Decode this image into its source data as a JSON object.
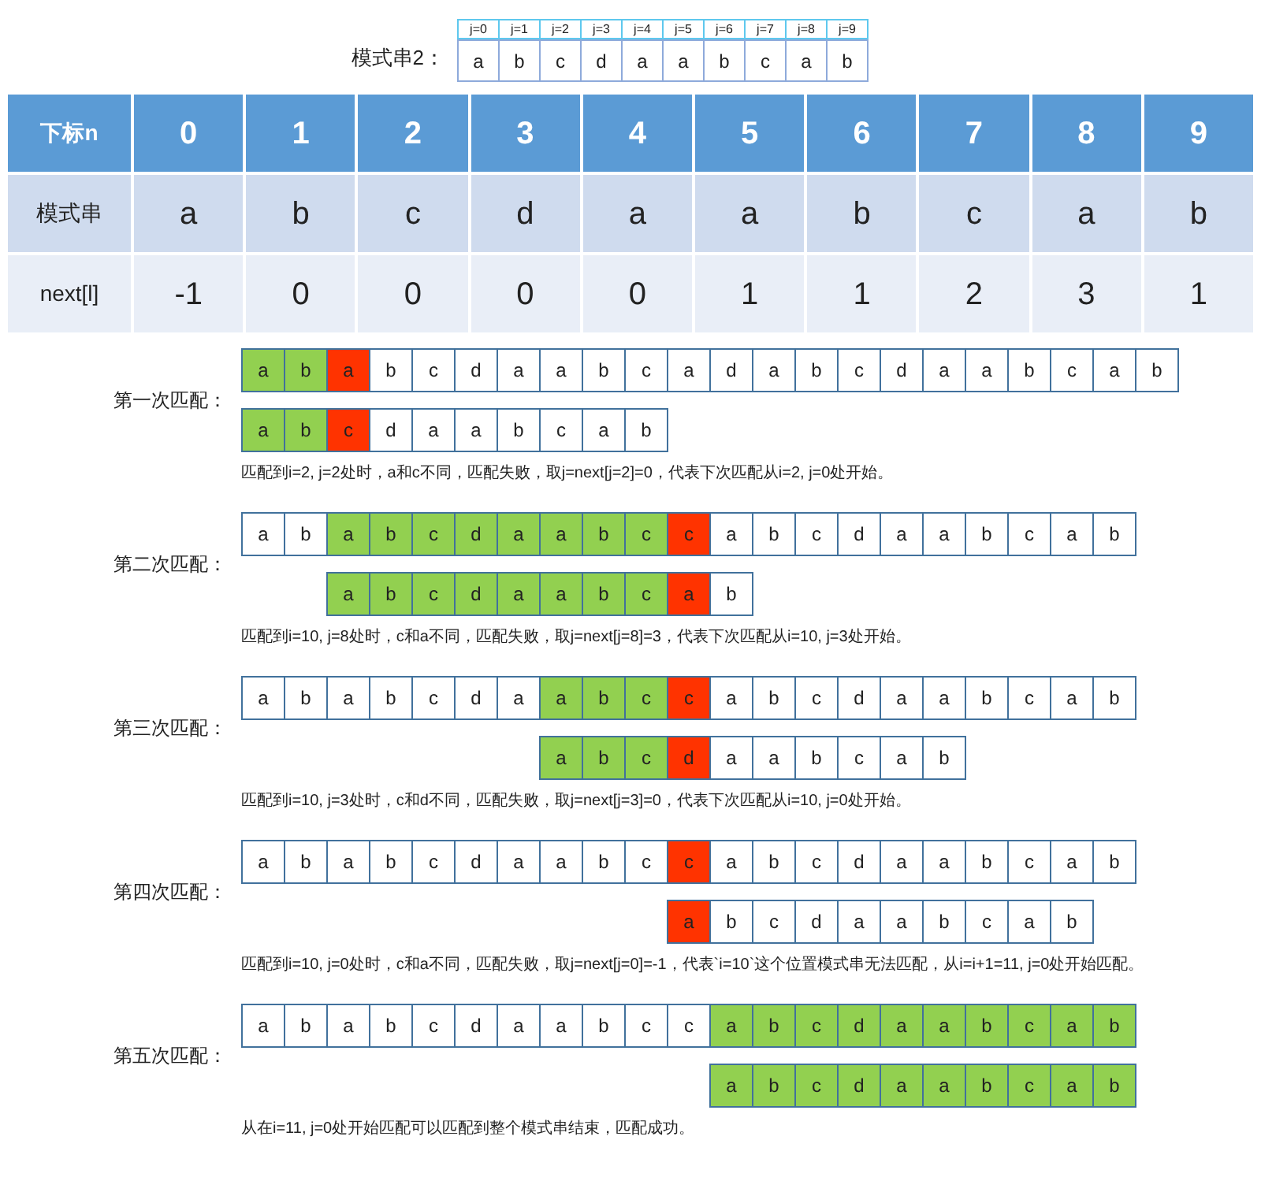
{
  "pattern_2": {
    "label": "模式串2：",
    "indices": [
      "j=0",
      "j=1",
      "j=2",
      "j=3",
      "j=4",
      "j=5",
      "j=6",
      "j=7",
      "j=8",
      "j=9"
    ],
    "chars": [
      "a",
      "b",
      "c",
      "d",
      "a",
      "a",
      "b",
      "c",
      "a",
      "b"
    ]
  },
  "table": {
    "rows": [
      {
        "kind": "header",
        "label": "下标n",
        "cells": [
          "0",
          "1",
          "2",
          "3",
          "4",
          "5",
          "6",
          "7",
          "8",
          "9"
        ]
      },
      {
        "kind": "pattern",
        "label": "模式串",
        "cells": [
          "a",
          "b",
          "c",
          "d",
          "a",
          "a",
          "b",
          "c",
          "a",
          "b"
        ]
      },
      {
        "kind": "next",
        "label": "next[l]",
        "cells": [
          "-1",
          "0",
          "0",
          "0",
          "0",
          "1",
          "1",
          "2",
          "3",
          "1"
        ]
      }
    ]
  },
  "rounds": [
    {
      "label": "第一次匹配：",
      "main": [
        {
          "c": "a",
          "matched": true,
          "mismatched": false
        },
        {
          "c": "b",
          "matched": true,
          "mismatched": false
        },
        {
          "c": "a",
          "matched": false,
          "mismatched": true
        },
        {
          "c": "b",
          "matched": false,
          "mismatched": false
        },
        {
          "c": "c",
          "matched": false,
          "mismatched": false
        },
        {
          "c": "d",
          "matched": false,
          "mismatched": false
        },
        {
          "c": "a",
          "matched": false,
          "mismatched": false
        },
        {
          "c": "a",
          "matched": false,
          "mismatched": false
        },
        {
          "c": "b",
          "matched": false,
          "mismatched": false
        },
        {
          "c": "c",
          "matched": false,
          "mismatched": false
        },
        {
          "c": "a",
          "matched": false,
          "mismatched": false
        },
        {
          "c": "d",
          "matched": false,
          "mismatched": false
        },
        {
          "c": "a",
          "matched": false,
          "mismatched": false
        },
        {
          "c": "b",
          "matched": false,
          "mismatched": false
        },
        {
          "c": "c",
          "matched": false,
          "mismatched": false
        },
        {
          "c": "d",
          "matched": false,
          "mismatched": false
        },
        {
          "c": "a",
          "matched": false,
          "mismatched": false
        },
        {
          "c": "a",
          "matched": false,
          "mismatched": false
        },
        {
          "c": "b",
          "matched": false,
          "mismatched": false
        },
        {
          "c": "c",
          "matched": false,
          "mismatched": false
        },
        {
          "c": "a",
          "matched": false,
          "mismatched": false
        },
        {
          "c": "b",
          "matched": false,
          "mismatched": false
        }
      ],
      "pattern": [
        {
          "c": "a",
          "matched": true,
          "mismatched": false
        },
        {
          "c": "b",
          "matched": true,
          "mismatched": false
        },
        {
          "c": "c",
          "matched": false,
          "mismatched": true
        },
        {
          "c": "d",
          "matched": false,
          "mismatched": false
        },
        {
          "c": "a",
          "matched": false,
          "mismatched": false
        },
        {
          "c": "a",
          "matched": false,
          "mismatched": false
        },
        {
          "c": "b",
          "matched": false,
          "mismatched": false
        },
        {
          "c": "c",
          "matched": false,
          "mismatched": false
        },
        {
          "c": "a",
          "matched": false,
          "mismatched": false
        },
        {
          "c": "b",
          "matched": false,
          "mismatched": false
        }
      ],
      "caption": "匹配到i=2, j=2处时，a和c不同，匹配失败，取j=next[j=2]=0，代表下次匹配从i=2, j=0处开始。"
    },
    {
      "label": "第二次匹配：",
      "main": [
        {
          "c": "a",
          "matched": false,
          "mismatched": false
        },
        {
          "c": "b",
          "matched": false,
          "mismatched": false
        },
        {
          "c": "a",
          "matched": true,
          "mismatched": false
        },
        {
          "c": "b",
          "matched": true,
          "mismatched": false
        },
        {
          "c": "c",
          "matched": true,
          "mismatched": false
        },
        {
          "c": "d",
          "matched": true,
          "mismatched": false
        },
        {
          "c": "a",
          "matched": true,
          "mismatched": false
        },
        {
          "c": "a",
          "matched": true,
          "mismatched": false
        },
        {
          "c": "b",
          "matched": true,
          "mismatched": false
        },
        {
          "c": "c",
          "matched": true,
          "mismatched": false
        },
        {
          "c": "c",
          "matched": false,
          "mismatched": true
        },
        {
          "c": "a",
          "matched": false,
          "mismatched": false
        },
        {
          "c": "b",
          "matched": false,
          "mismatched": false
        },
        {
          "c": "c",
          "matched": false,
          "mismatched": false
        },
        {
          "c": "d",
          "matched": false,
          "mismatched": false
        },
        {
          "c": "a",
          "matched": false,
          "mismatched": false
        },
        {
          "c": "a",
          "matched": false,
          "mismatched": false
        },
        {
          "c": "b",
          "matched": false,
          "mismatched": false
        },
        {
          "c": "c",
          "matched": false,
          "mismatched": false
        },
        {
          "c": "a",
          "matched": false,
          "mismatched": false
        },
        {
          "c": "b",
          "matched": false,
          "mismatched": false
        }
      ],
      "pattern": [
        {
          "c": "a",
          "matched": true,
          "mismatched": false
        },
        {
          "c": "b",
          "matched": true,
          "mismatched": false
        },
        {
          "c": "c",
          "matched": true,
          "mismatched": false
        },
        {
          "c": "d",
          "matched": true,
          "mismatched": false
        },
        {
          "c": "a",
          "matched": true,
          "mismatched": false
        },
        {
          "c": "a",
          "matched": true,
          "mismatched": false
        },
        {
          "c": "b",
          "matched": true,
          "mismatched": false
        },
        {
          "c": "c",
          "matched": true,
          "mismatched": false
        },
        {
          "c": "a",
          "matched": false,
          "mismatched": true
        },
        {
          "c": "b",
          "matched": false,
          "mismatched": false
        }
      ],
      "caption": "匹配到i=10, j=8处时，c和a不同，匹配失败，取j=next[j=8]=3，代表下次匹配从i=10, j=3处开始。"
    },
    {
      "label": "第三次匹配：",
      "main": [
        {
          "c": "a",
          "matched": false,
          "mismatched": false
        },
        {
          "c": "b",
          "matched": false,
          "mismatched": false
        },
        {
          "c": "a",
          "matched": false,
          "mismatched": false
        },
        {
          "c": "b",
          "matched": false,
          "mismatched": false
        },
        {
          "c": "c",
          "matched": false,
          "mismatched": false
        },
        {
          "c": "d",
          "matched": false,
          "mismatched": false
        },
        {
          "c": "a",
          "matched": false,
          "mismatched": false
        },
        {
          "c": "a",
          "matched": true,
          "mismatched": false
        },
        {
          "c": "b",
          "matched": true,
          "mismatched": false
        },
        {
          "c": "c",
          "matched": true,
          "mismatched": false
        },
        {
          "c": "c",
          "matched": false,
          "mismatched": true
        },
        {
          "c": "a",
          "matched": false,
          "mismatched": false
        },
        {
          "c": "b",
          "matched": false,
          "mismatched": false
        },
        {
          "c": "c",
          "matched": false,
          "mismatched": false
        },
        {
          "c": "d",
          "matched": false,
          "mismatched": false
        },
        {
          "c": "a",
          "matched": false,
          "mismatched": false
        },
        {
          "c": "a",
          "matched": false,
          "mismatched": false
        },
        {
          "c": "b",
          "matched": false,
          "mismatched": false
        },
        {
          "c": "c",
          "matched": false,
          "mismatched": false
        },
        {
          "c": "a",
          "matched": false,
          "mismatched": false
        },
        {
          "c": "b",
          "matched": false,
          "mismatched": false
        }
      ],
      "pattern": [
        {
          "c": "a",
          "matched": true,
          "mismatched": false
        },
        {
          "c": "b",
          "matched": true,
          "mismatched": false
        },
        {
          "c": "c",
          "matched": true,
          "mismatched": false
        },
        {
          "c": "d",
          "matched": false,
          "mismatched": true
        },
        {
          "c": "a",
          "matched": false,
          "mismatched": false
        },
        {
          "c": "a",
          "matched": false,
          "mismatched": false
        },
        {
          "c": "b",
          "matched": false,
          "mismatched": false
        },
        {
          "c": "c",
          "matched": false,
          "mismatched": false
        },
        {
          "c": "a",
          "matched": false,
          "mismatched": false
        },
        {
          "c": "b",
          "matched": false,
          "mismatched": false
        }
      ],
      "caption": "匹配到i=10, j=3处时，c和d不同，匹配失败，取j=next[j=3]=0，代表下次匹配从i=10, j=0处开始。"
    },
    {
      "label": "第四次匹配：",
      "main": [
        {
          "c": "a",
          "matched": false,
          "mismatched": false
        },
        {
          "c": "b",
          "matched": false,
          "mismatched": false
        },
        {
          "c": "a",
          "matched": false,
          "mismatched": false
        },
        {
          "c": "b",
          "matched": false,
          "mismatched": false
        },
        {
          "c": "c",
          "matched": false,
          "mismatched": false
        },
        {
          "c": "d",
          "matched": false,
          "mismatched": false
        },
        {
          "c": "a",
          "matched": false,
          "mismatched": false
        },
        {
          "c": "a",
          "matched": false,
          "mismatched": false
        },
        {
          "c": "b",
          "matched": false,
          "mismatched": false
        },
        {
          "c": "c",
          "matched": false,
          "mismatched": false
        },
        {
          "c": "c",
          "matched": false,
          "mismatched": true
        },
        {
          "c": "a",
          "matched": false,
          "mismatched": false
        },
        {
          "c": "b",
          "matched": false,
          "mismatched": false
        },
        {
          "c": "c",
          "matched": false,
          "mismatched": false
        },
        {
          "c": "d",
          "matched": false,
          "mismatched": false
        },
        {
          "c": "a",
          "matched": false,
          "mismatched": false
        },
        {
          "c": "a",
          "matched": false,
          "mismatched": false
        },
        {
          "c": "b",
          "matched": false,
          "mismatched": false
        },
        {
          "c": "c",
          "matched": false,
          "mismatched": false
        },
        {
          "c": "a",
          "matched": false,
          "mismatched": false
        },
        {
          "c": "b",
          "matched": false,
          "mismatched": false
        }
      ],
      "pattern": [
        {
          "c": "a",
          "matched": false,
          "mismatched": true
        },
        {
          "c": "b",
          "matched": false,
          "mismatched": false
        },
        {
          "c": "c",
          "matched": false,
          "mismatched": false
        },
        {
          "c": "d",
          "matched": false,
          "mismatched": false
        },
        {
          "c": "a",
          "matched": false,
          "mismatched": false
        },
        {
          "c": "a",
          "matched": false,
          "mismatched": false
        },
        {
          "c": "b",
          "matched": false,
          "mismatched": false
        },
        {
          "c": "c",
          "matched": false,
          "mismatched": false
        },
        {
          "c": "a",
          "matched": false,
          "mismatched": false
        },
        {
          "c": "b",
          "matched": false,
          "mismatched": false
        }
      ],
      "caption": "匹配到i=10, j=0处时，c和a不同，匹配失败，取j=next[j=0]=-1，代表`i=10`这个位置模式串无法匹配，从i=i+1=11, j=0处开始匹配。"
    },
    {
      "label": "第五次匹配：",
      "main": [
        {
          "c": "a",
          "matched": false,
          "mismatched": false
        },
        {
          "c": "b",
          "matched": false,
          "mismatched": false
        },
        {
          "c": "a",
          "matched": false,
          "mismatched": false
        },
        {
          "c": "b",
          "matched": false,
          "mismatched": false
        },
        {
          "c": "c",
          "matched": false,
          "mismatched": false
        },
        {
          "c": "d",
          "matched": false,
          "mismatched": false
        },
        {
          "c": "a",
          "matched": false,
          "mismatched": false
        },
        {
          "c": "a",
          "matched": false,
          "mismatched": false
        },
        {
          "c": "b",
          "matched": false,
          "mismatched": false
        },
        {
          "c": "c",
          "matched": false,
          "mismatched": false
        },
        {
          "c": "c",
          "matched": false,
          "mismatched": false
        },
        {
          "c": "a",
          "matched": true,
          "mismatched": false
        },
        {
          "c": "b",
          "matched": true,
          "mismatched": false
        },
        {
          "c": "c",
          "matched": true,
          "mismatched": false
        },
        {
          "c": "d",
          "matched": true,
          "mismatched": false
        },
        {
          "c": "a",
          "matched": true,
          "mismatched": false
        },
        {
          "c": "a",
          "matched": true,
          "mismatched": false
        },
        {
          "c": "b",
          "matched": true,
          "mismatched": false
        },
        {
          "c": "c",
          "matched": true,
          "mismatched": false
        },
        {
          "c": "a",
          "matched": true,
          "mismatched": false
        },
        {
          "c": "b",
          "matched": true,
          "mismatched": false
        }
      ],
      "pattern": [
        {
          "c": "a",
          "matched": true,
          "mismatched": false
        },
        {
          "c": "b",
          "matched": true,
          "mismatched": false
        },
        {
          "c": "c",
          "matched": true,
          "mismatched": false
        },
        {
          "c": "d",
          "matched": true,
          "mismatched": false
        },
        {
          "c": "a",
          "matched": true,
          "mismatched": false
        },
        {
          "c": "a",
          "matched": true,
          "mismatched": false
        },
        {
          "c": "b",
          "matched": true,
          "mismatched": false
        },
        {
          "c": "c",
          "matched": true,
          "mismatched": false
        },
        {
          "c": "a",
          "matched": true,
          "mismatched": false
        },
        {
          "c": "b",
          "matched": true,
          "mismatched": false
        }
      ],
      "caption": "从在i=11, j=0处开始匹配可以匹配到整个模式串结束，匹配成功。"
    }
  ]
}
